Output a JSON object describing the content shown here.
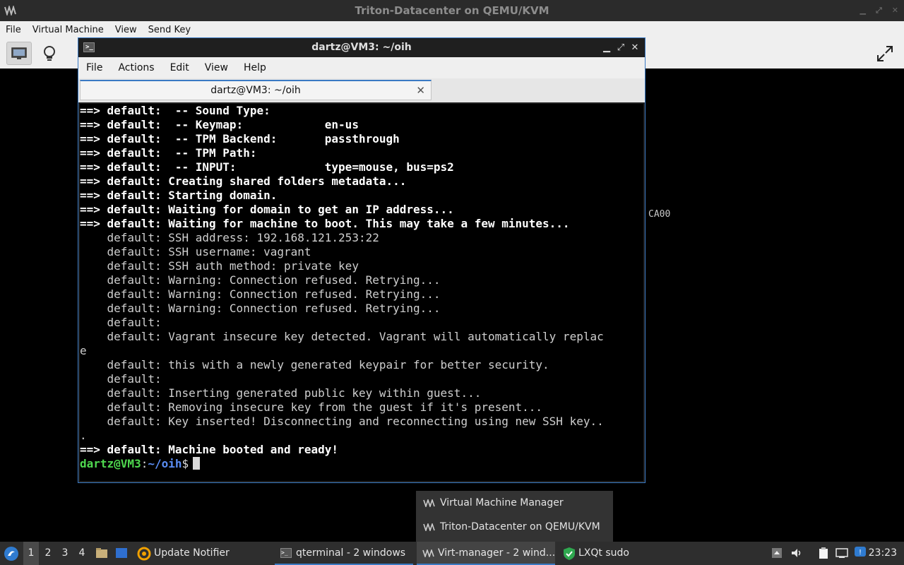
{
  "outer_window": {
    "title": "Triton-Datacenter on QEMU/KVM",
    "menu": [
      "File",
      "Virtual Machine",
      "View",
      "Send Key"
    ]
  },
  "guest_console_text": "CA00",
  "terminal": {
    "title": "dartz@VM3: ~/oih",
    "menu": [
      "File",
      "Actions",
      "Edit",
      "View",
      "Help"
    ],
    "tab_title": "dartz@VM3: ~/oih",
    "lines": [
      {
        "text": "==> default:  -- Sound Type:",
        "bold": true
      },
      {
        "text": "==> default:  -- Keymap:            en-us",
        "bold": true
      },
      {
        "text": "==> default:  -- TPM Backend:       passthrough",
        "bold": true
      },
      {
        "text": "==> default:  -- TPM Path:",
        "bold": true
      },
      {
        "text": "==> default:  -- INPUT:             type=mouse, bus=ps2",
        "bold": true
      },
      {
        "text": "==> default: Creating shared folders metadata...",
        "bold": true
      },
      {
        "text": "==> default: Starting domain.",
        "bold": true
      },
      {
        "text": "==> default: Waiting for domain to get an IP address...",
        "bold": true
      },
      {
        "text": "==> default: Waiting for machine to boot. This may take a few minutes...",
        "bold": true
      },
      {
        "text": "    default: SSH address: 192.168.121.253:22",
        "bold": false
      },
      {
        "text": "    default: SSH username: vagrant",
        "bold": false
      },
      {
        "text": "    default: SSH auth method: private key",
        "bold": false
      },
      {
        "text": "    default: Warning: Connection refused. Retrying...",
        "bold": false
      },
      {
        "text": "    default: Warning: Connection refused. Retrying...",
        "bold": false
      },
      {
        "text": "    default: Warning: Connection refused. Retrying...",
        "bold": false
      },
      {
        "text": "    default:",
        "bold": false
      },
      {
        "text": "    default: Vagrant insecure key detected. Vagrant will automatically replac",
        "bold": false
      },
      {
        "text": "e",
        "bold": false
      },
      {
        "text": "    default: this with a newly generated keypair for better security.",
        "bold": false
      },
      {
        "text": "    default:",
        "bold": false
      },
      {
        "text": "    default: Inserting generated public key within guest...",
        "bold": false
      },
      {
        "text": "    default: Removing insecure key from the guest if it's present...",
        "bold": false
      },
      {
        "text": "    default: Key inserted! Disconnecting and reconnecting using new SSH key..",
        "bold": false
      },
      {
        "text": ".",
        "bold": false
      },
      {
        "text": "==> default: Machine booted and ready!",
        "bold": true
      }
    ],
    "prompt": {
      "user_host": "dartz@VM3",
      "sep": ":",
      "path": "~/oih",
      "symbol": "$"
    }
  },
  "popup": {
    "items": [
      "Virtual Machine Manager",
      "Triton-Datacenter on QEMU/KVM"
    ]
  },
  "taskbar": {
    "workspaces": [
      "1",
      "2",
      "3",
      "4"
    ],
    "active_workspace": "1",
    "tasks": {
      "update_notifier": "Update Notifier",
      "qterminal": "qterminal - 2 windows",
      "virt_manager": "Virt-manager - 2 wind...",
      "lxqt_sudo": "LXQt sudo"
    },
    "clock": "23:23"
  }
}
